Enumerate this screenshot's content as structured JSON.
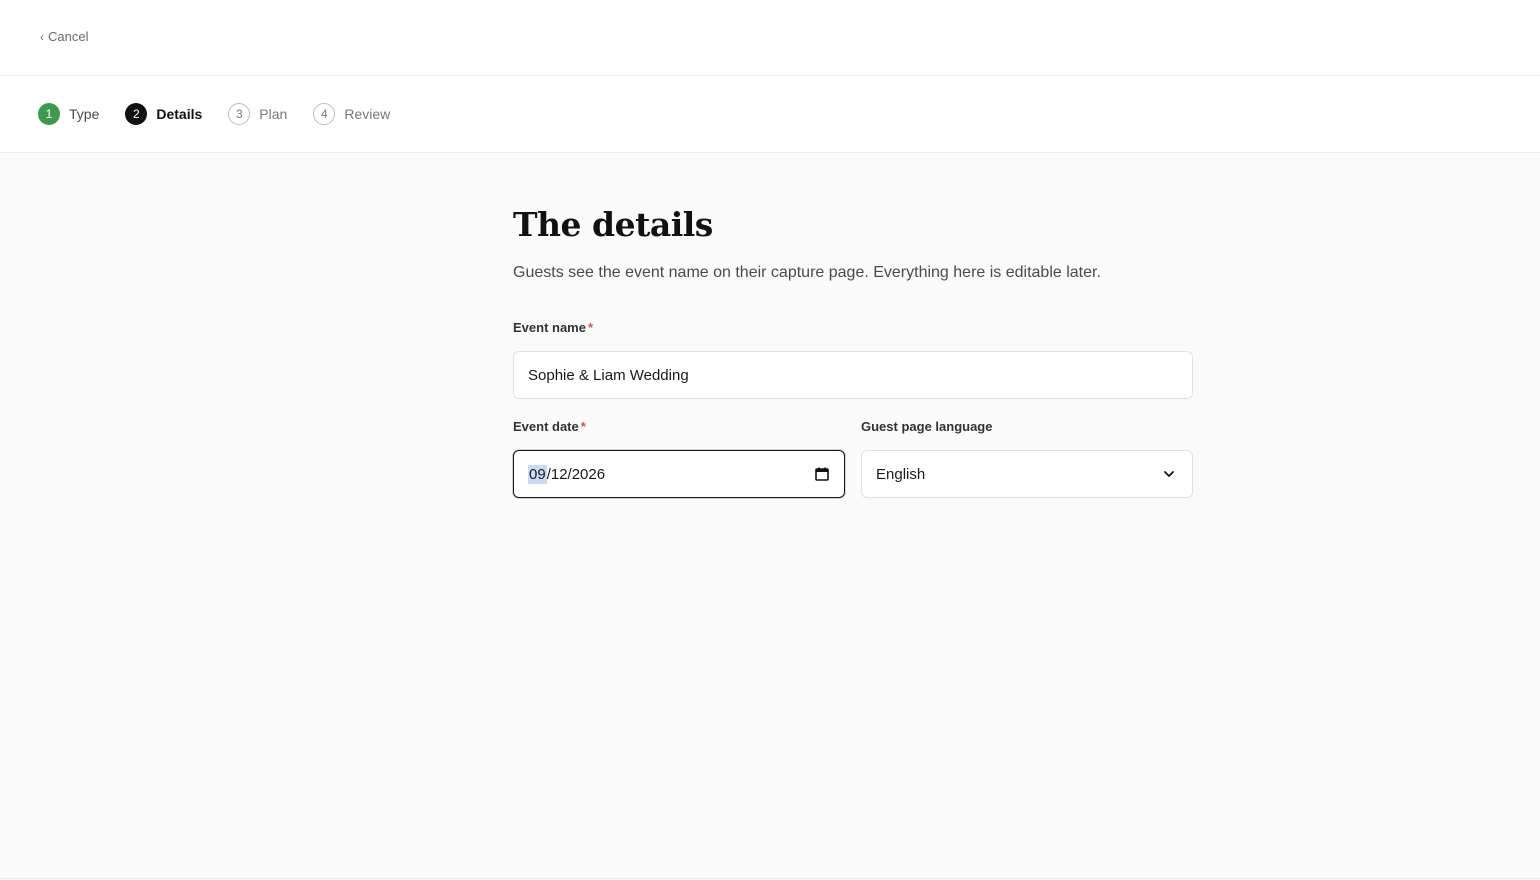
{
  "topbar": {
    "cancel_label": "Cancel",
    "cancel_icon": "chevron-left-icon"
  },
  "stepper": {
    "steps": [
      {
        "number": "1",
        "label": "Type",
        "state": "done"
      },
      {
        "number": "2",
        "label": "Details",
        "state": "current"
      },
      {
        "number": "3",
        "label": "Plan",
        "state": "upcoming"
      },
      {
        "number": "4",
        "label": "Review",
        "state": "upcoming"
      }
    ]
  },
  "colors": {
    "done_step": "#3d9a4d",
    "current_step": "#111111",
    "required_marker": "#d9534f",
    "date_selection": "#c9daf6"
  },
  "form": {
    "title": "The details",
    "subtitle": "Guests see the event name on their capture page. Everything here is editable later.",
    "event_name": {
      "label": "Event name",
      "required_marker": "*",
      "value": "Sophie & Liam Wedding"
    },
    "event_date": {
      "label": "Event date",
      "required_marker": "*",
      "month": "09",
      "rest": "/12/2026",
      "icon": "calendar-icon"
    },
    "language": {
      "label": "Guest page language",
      "selected": "English",
      "icon": "chevron-down-icon"
    }
  }
}
